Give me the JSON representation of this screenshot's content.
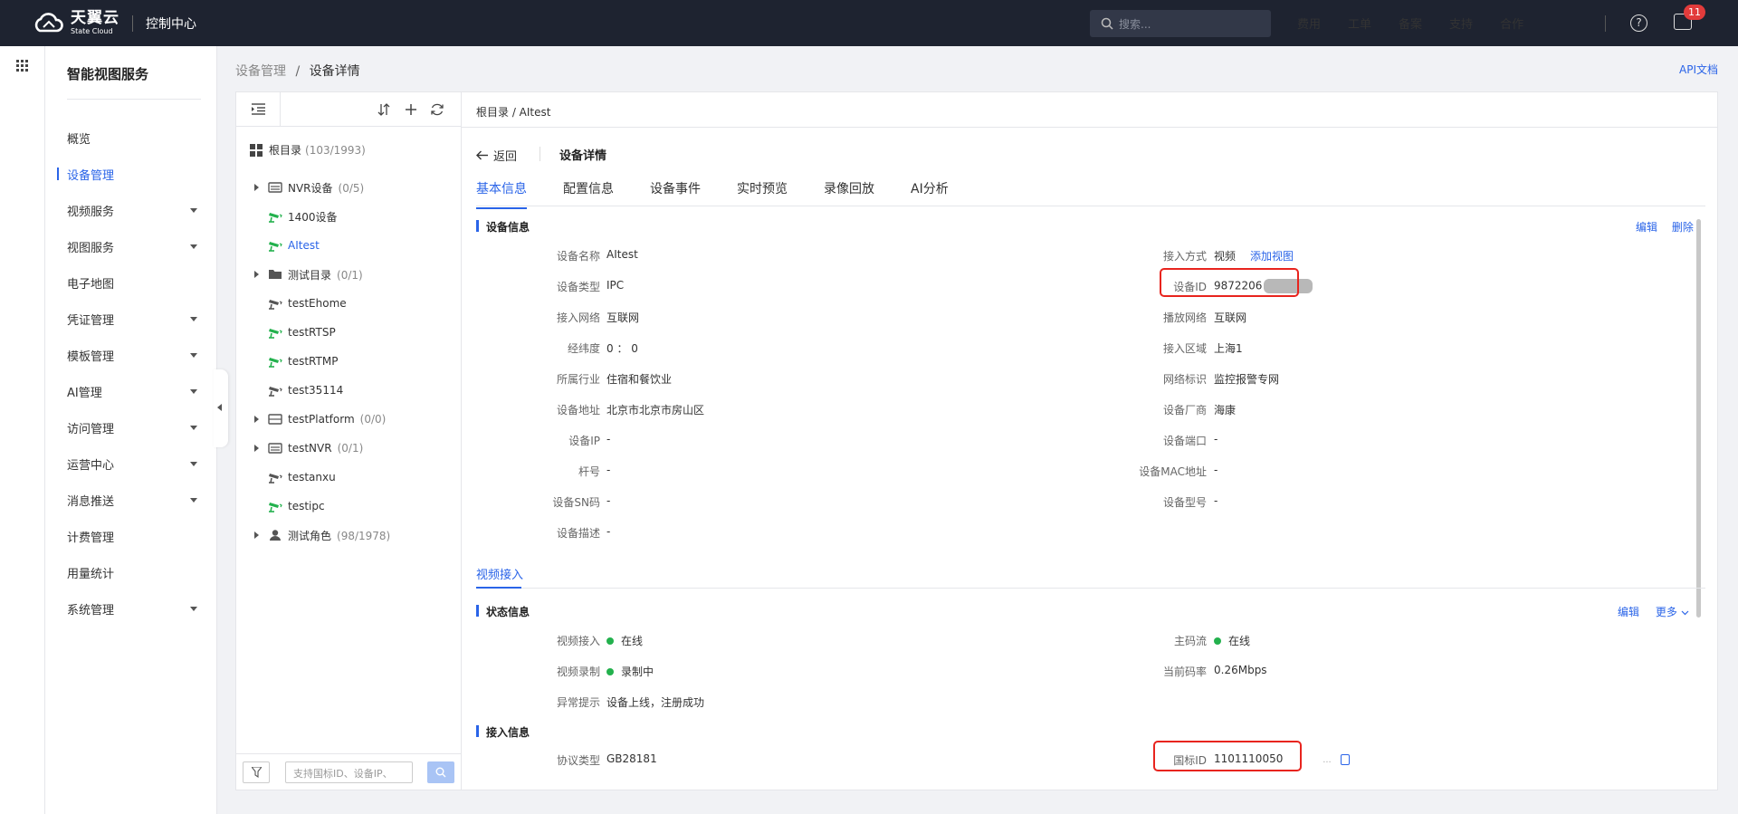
{
  "topbar": {
    "logo_cn": "天翼云",
    "logo_en": "State Cloud",
    "console": "控制中心",
    "search_placeholder": "搜索...",
    "nav": [
      "费用",
      "工单",
      "备案",
      "支持",
      "合作"
    ],
    "badge": "11"
  },
  "sidebar": {
    "title": "智能视图服务",
    "items": [
      {
        "label": "概览",
        "caret": false
      },
      {
        "label": "设备管理",
        "caret": false,
        "active": true
      },
      {
        "label": "视频服务",
        "caret": true
      },
      {
        "label": "视图服务",
        "caret": true
      },
      {
        "label": "电子地图",
        "caret": false
      },
      {
        "label": "凭证管理",
        "caret": true
      },
      {
        "label": "模板管理",
        "caret": true
      },
      {
        "label": "AI管理",
        "caret": true
      },
      {
        "label": "访问管理",
        "caret": true
      },
      {
        "label": "运营中心",
        "caret": true
      },
      {
        "label": "消息推送",
        "caret": true
      },
      {
        "label": "计费管理",
        "caret": false
      },
      {
        "label": "用量统计",
        "caret": false
      },
      {
        "label": "系统管理",
        "caret": true
      }
    ]
  },
  "breadcrumb": {
    "parent": "设备管理",
    "sep": "/",
    "current": "设备详情"
  },
  "api_doc": "API文档",
  "tree": {
    "root_label": "根目录",
    "root_count": "(103/1993)",
    "nodes": [
      {
        "label": "NVR设备",
        "count": "(0/5)",
        "arrow": true,
        "icon": "nvr"
      },
      {
        "label": "1400设备",
        "count": "",
        "arrow": false,
        "icon": "camera-green"
      },
      {
        "label": "AItest",
        "count": "",
        "arrow": false,
        "icon": "camera-green",
        "selected": true
      },
      {
        "label": "测试目录",
        "count": "(0/1)",
        "arrow": true,
        "icon": "folder"
      },
      {
        "label": "testEhome",
        "count": "",
        "arrow": false,
        "icon": "camera-gray"
      },
      {
        "label": "testRTSP",
        "count": "",
        "arrow": false,
        "icon": "camera-green"
      },
      {
        "label": "testRTMP",
        "count": "",
        "arrow": false,
        "icon": "camera-green"
      },
      {
        "label": "test35114",
        "count": "",
        "arrow": false,
        "icon": "camera-gray"
      },
      {
        "label": "testPlatform",
        "count": "(0/0)",
        "arrow": true,
        "icon": "platform"
      },
      {
        "label": "testNVR",
        "count": "(0/1)",
        "arrow": true,
        "icon": "nvr"
      },
      {
        "label": "testanxu",
        "count": "",
        "arrow": false,
        "icon": "camera-gray"
      },
      {
        "label": "testipc",
        "count": "",
        "arrow": false,
        "icon": "camera-green"
      },
      {
        "label": "测试角色",
        "count": "(98/1978)",
        "arrow": true,
        "icon": "role"
      }
    ],
    "search_placeholder": "支持国标ID、设备IP、"
  },
  "detail": {
    "crumb": "根目录  /  AItest",
    "back": "返回",
    "title": "设备详情",
    "tabs": [
      "基本信息",
      "配置信息",
      "设备事件",
      "实时预览",
      "录像回放",
      "AI分析"
    ],
    "device_info_head": "设备信息",
    "edit": "编辑",
    "delete": "删除",
    "left_rows": [
      {
        "label": "设备名称",
        "value": "AItest"
      },
      {
        "label": "设备类型",
        "value": "IPC"
      },
      {
        "label": "接入网络",
        "value": "互联网"
      },
      {
        "label": "经纬度",
        "value": "0 ： 0"
      },
      {
        "label": "所属行业",
        "value": "住宿和餐饮业"
      },
      {
        "label": "设备地址",
        "value": "北京市北京市房山区"
      },
      {
        "label": "设备IP",
        "value": "-"
      },
      {
        "label": "杆号",
        "value": "-"
      },
      {
        "label": "设备SN码",
        "value": "-"
      },
      {
        "label": "设备描述",
        "value": "-"
      }
    ],
    "right_rows": [
      {
        "label": "接入方式",
        "value": "视频"
      },
      {
        "label": "设备ID",
        "value": "9872206"
      },
      {
        "label": "播放网络",
        "value": "互联网"
      },
      {
        "label": "接入区域",
        "value": "上海1"
      },
      {
        "label": "网络标识",
        "value": "监控报警专网"
      },
      {
        "label": "设备厂商",
        "value": "海康"
      },
      {
        "label": "设备端口",
        "value": "-"
      },
      {
        "label": "设备MAC地址",
        "value": "-"
      },
      {
        "label": "设备型号",
        "value": "-"
      }
    ],
    "add_view": "添加视图",
    "subtab": "视频接入",
    "status_head": "状态信息",
    "edit2": "编辑",
    "more": "更多",
    "status_left": [
      {
        "label": "视频接入",
        "value": "在线",
        "dot": true
      },
      {
        "label": "视频录制",
        "value": "录制中",
        "dot": true
      },
      {
        "label": "异常提示",
        "value": "设备上线，注册成功",
        "dot": false
      }
    ],
    "status_right": [
      {
        "label": "主码流",
        "value": "在线",
        "dot": true
      },
      {
        "label": "当前码率",
        "value": "0.26Mbps",
        "dot": false
      }
    ],
    "access_head": "接入信息",
    "protocol_label": "协议类型",
    "protocol_value": "GB28181",
    "gb_label": "国标ID",
    "gb_value": "1101110050",
    "gb_tail": "..."
  },
  "colors": {
    "accent": "#2a64e8",
    "online": "#23b14d",
    "highlight": "#e8241e"
  }
}
